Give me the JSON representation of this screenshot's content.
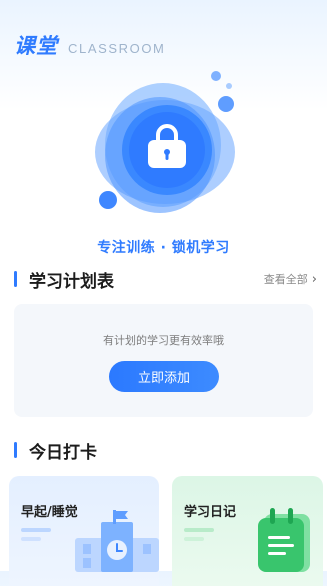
{
  "header": {
    "title": "课堂",
    "subtitle": "CLASSROOM"
  },
  "hero": {
    "icon": "lock-icon",
    "caption": "专注训练 · 锁机学习"
  },
  "plan_section": {
    "title": "学习计划表",
    "view_all": "查看全部",
    "empty_text": "有计划的学习更有效率哦",
    "add_button": "立即添加"
  },
  "checkin_section": {
    "title": "今日打卡",
    "cards": [
      {
        "label": "早起/睡觉",
        "icon": "school-clock-icon"
      },
      {
        "label": "学习日记",
        "icon": "notebook-icon"
      }
    ]
  },
  "colors": {
    "accent": "#2f7bff",
    "card_bg": "#f4f7fb",
    "green_card": "#dcf6e6"
  }
}
